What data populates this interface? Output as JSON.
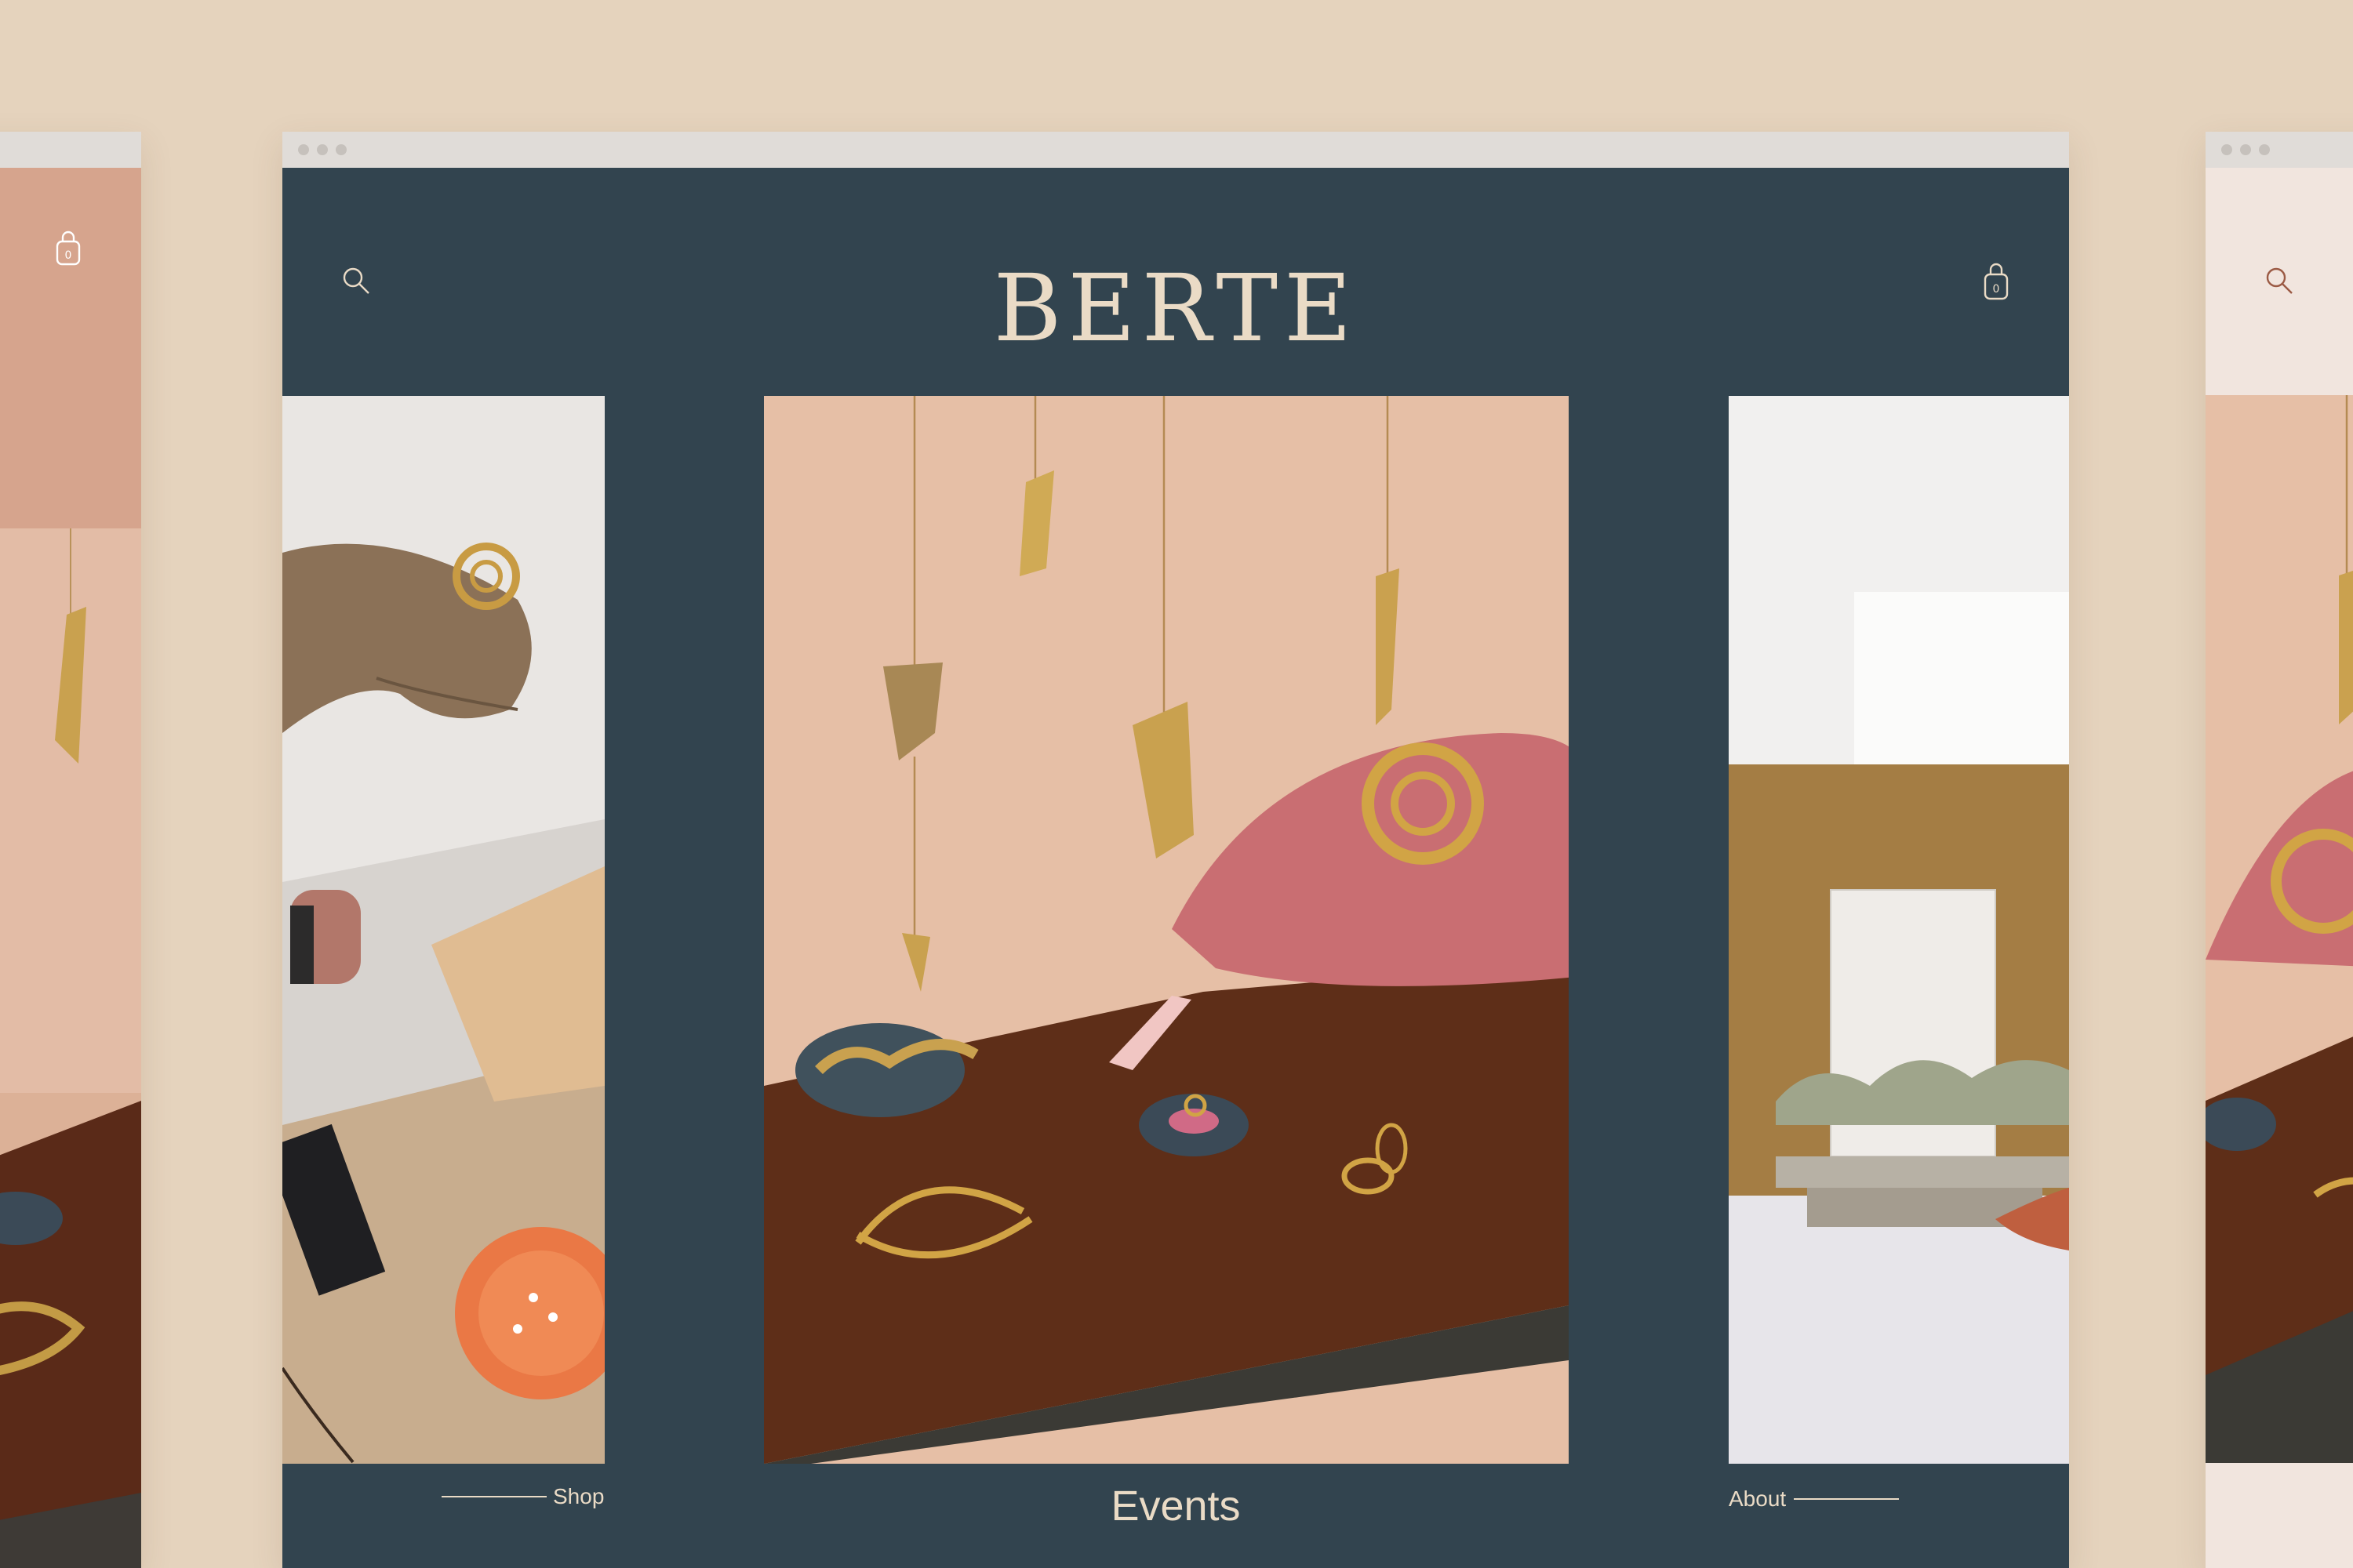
{
  "brand": {
    "logo_text": "BERTE"
  },
  "header": {
    "search_icon": "search-icon",
    "cart_icon": "shopping-bag-icon",
    "cart_count": "0"
  },
  "sections": {
    "shop_label": "Shop",
    "events_label": "Events",
    "about_label": "About"
  },
  "side_windows": {
    "left_cart_count": "0"
  },
  "colors": {
    "page_background": "#e5d3bd",
    "main_window_background": "#32444f",
    "logo_color": "#eadbc6",
    "left_window_accent": "#d6a48d",
    "right_window_background": "#f1e5de",
    "browser_chrome": "#e0dcd8"
  }
}
